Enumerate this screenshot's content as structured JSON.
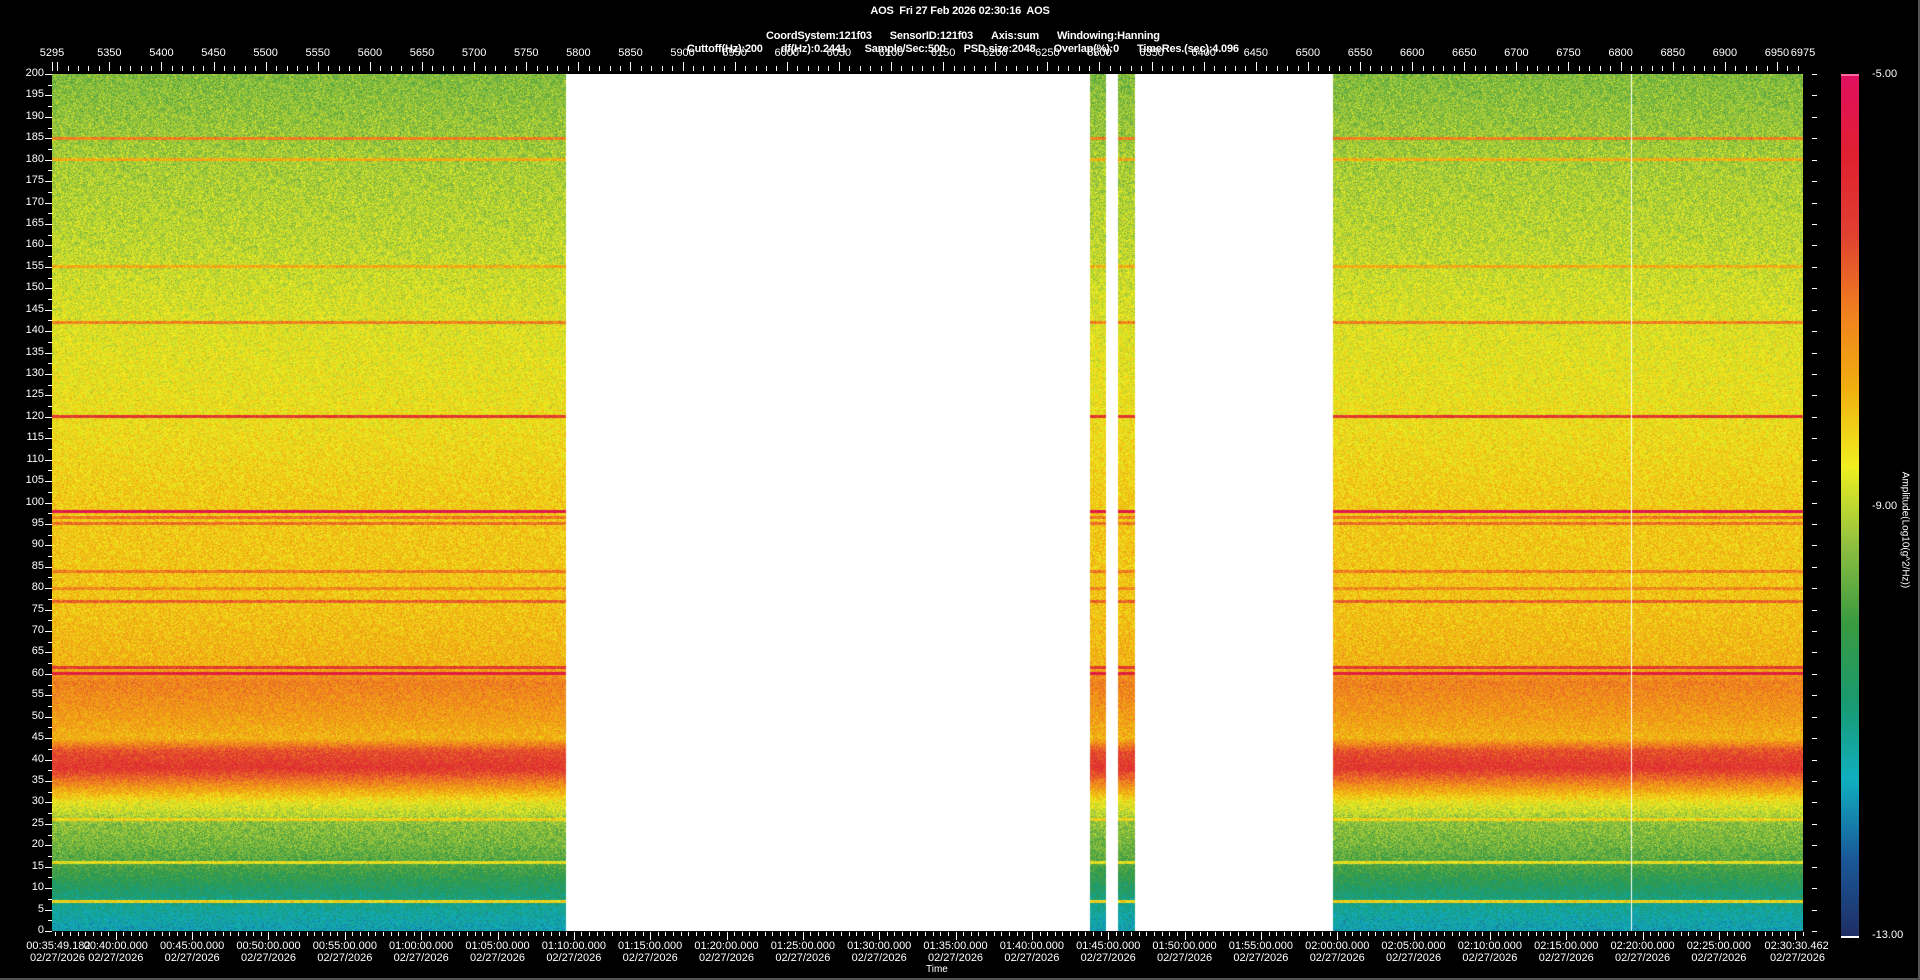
{
  "header": {
    "line1": "AOS  Fri 27 Feb 2026 02:30:16  AOS",
    "line2": [
      "CoordSystem:121f03",
      "SensorID:121f03",
      "Axis:sum",
      "Windowing:Hanning"
    ],
    "line3": [
      "Cuttoff(Hz):200",
      "df(Hz):0.2441",
      "Sample/Sec:500",
      "PSD size:2048",
      "Overlap(%):0",
      "TimeRes.(sec):4.096"
    ]
  },
  "chart_data": {
    "type": "heatmap",
    "top_axis": {
      "range": [
        5295,
        6975
      ],
      "tick_labels": [
        "5295",
        "5350",
        "5400",
        "5450",
        "5500",
        "5550",
        "5600",
        "5650",
        "5700",
        "5750",
        "5800",
        "5850",
        "5900",
        "5950",
        "6000",
        "6050",
        "6100",
        "6150",
        "6200",
        "6250",
        "6300",
        "6350",
        "6400",
        "6450",
        "6500",
        "6550",
        "6600",
        "6650",
        "6700",
        "6750",
        "6800",
        "6850",
        "6900",
        "6950",
        "6975"
      ]
    },
    "y_axis": {
      "range": [
        0,
        200
      ],
      "tick_labels": [
        "200",
        "195",
        "190",
        "185",
        "180",
        "175",
        "170",
        "165",
        "160",
        "155",
        "150",
        "145",
        "140",
        "135",
        "130",
        "125",
        "120",
        "115",
        "110",
        "105",
        "100",
        "95",
        "90",
        "85",
        "80",
        "75",
        "70",
        "65",
        "60",
        "55",
        "50",
        "45",
        "40",
        "35",
        "30",
        "25",
        "20",
        "15",
        "10",
        "5",
        "0"
      ]
    },
    "x_axis": {
      "title": "Time",
      "start": "00:35:49.182",
      "end": "02:30:30.462",
      "tick_labels": [
        {
          "time": "00:35:49.182",
          "date": "02/27/2026"
        },
        {
          "time": "00:40:00.000",
          "date": "02/27/2026"
        },
        {
          "time": "00:45:00.000",
          "date": "02/27/2026"
        },
        {
          "time": "00:50:00.000",
          "date": "02/27/2026"
        },
        {
          "time": "00:55:00.000",
          "date": "02/27/2026"
        },
        {
          "time": "01:00:00.000",
          "date": "02/27/2026"
        },
        {
          "time": "01:05:00.000",
          "date": "02/27/2026"
        },
        {
          "time": "01:10:00.000",
          "date": "02/27/2026"
        },
        {
          "time": "01:15:00.000",
          "date": "02/27/2026"
        },
        {
          "time": "01:20:00.000",
          "date": "02/27/2026"
        },
        {
          "time": "01:25:00.000",
          "date": "02/27/2026"
        },
        {
          "time": "01:30:00.000",
          "date": "02/27/2026"
        },
        {
          "time": "01:35:00.000",
          "date": "02/27/2026"
        },
        {
          "time": "01:40:00.000",
          "date": "02/27/2026"
        },
        {
          "time": "01:45:00.000",
          "date": "02/27/2026"
        },
        {
          "time": "01:50:00.000",
          "date": "02/27/2026"
        },
        {
          "time": "01:55:00.000",
          "date": "02/27/2026"
        },
        {
          "time": "02:00:00.000",
          "date": "02/27/2026"
        },
        {
          "time": "02:05:00.000",
          "date": "02/27/2026"
        },
        {
          "time": "02:10:00.000",
          "date": "02/27/2026"
        },
        {
          "time": "02:15:00.000",
          "date": "02/27/2026"
        },
        {
          "time": "02:20:00.000",
          "date": "02/27/2026"
        },
        {
          "time": "02:25:00.000",
          "date": "02/27/2026"
        },
        {
          "time": "02:30:30.462",
          "date": "02/27/2026"
        }
      ]
    },
    "data_segments_index": [
      [
        5295,
        5788
      ],
      [
        6291,
        6306
      ],
      [
        6318,
        6334
      ],
      [
        6524,
        6975
      ]
    ],
    "marker_index": 6810,
    "harmonic_lines_hz": [
      7,
      16,
      26,
      60,
      61.5,
      77,
      80,
      84,
      95,
      96.5,
      98,
      120,
      142,
      155,
      180,
      185
    ],
    "colorbar": {
      "title": "Amplitude(Log10(g^2/Hz))",
      "range": [
        -13,
        -5
      ],
      "tick_labels": [
        "-5.00",
        "-9.00",
        "-13.00"
      ],
      "colors": [
        "#1f2f66",
        "#1a5a9a",
        "#10b0c0",
        "#1a9a70",
        "#3a9a40",
        "#90c040",
        "#f0f020",
        "#f0b010",
        "#f08020",
        "#e04030",
        "#e02030",
        "#e01060"
      ]
    }
  }
}
